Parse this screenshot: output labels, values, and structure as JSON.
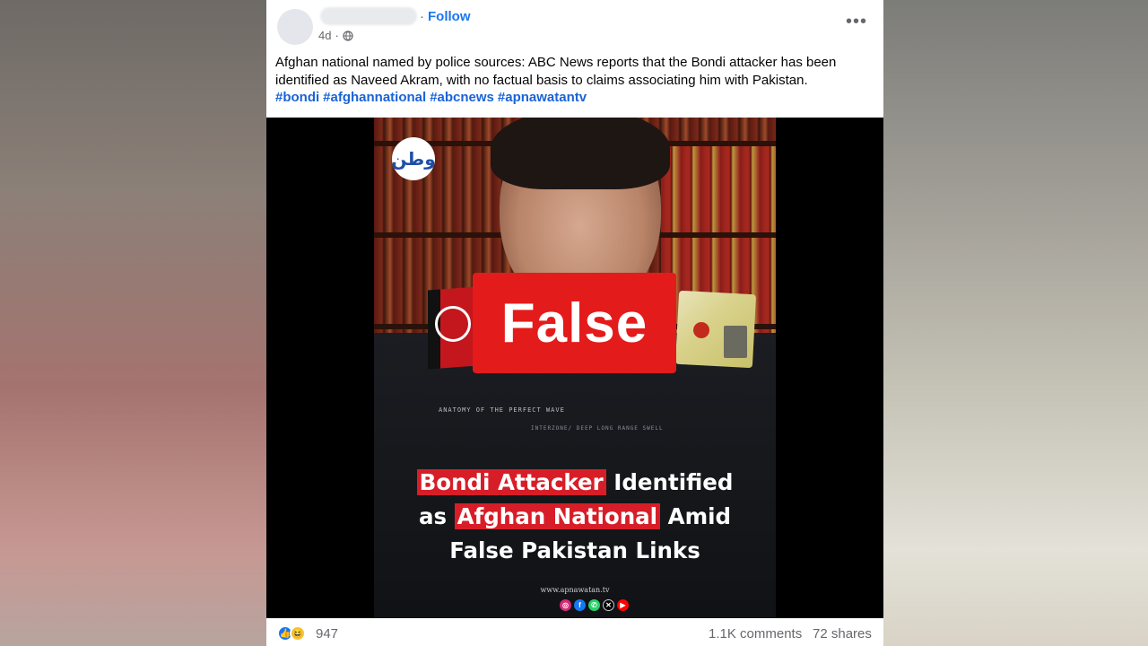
{
  "post": {
    "follow_separator": "·",
    "follow_label": "Follow",
    "time": "4d",
    "time_separator": "·",
    "caption": "Afghan national named by police sources: ABC News reports that the Bondi attacker has been identified as Naveed Akram, with no factual basis to claims associating him with Pakistan.",
    "hashtags": [
      "#bondi",
      "#afghannational",
      "#abcnews",
      "#apnawatantv"
    ],
    "more_label": "•••"
  },
  "media": {
    "logo_text": "وطن",
    "false_badge": "False",
    "shirt_line1": "ANATOMY OF THE PERFECT WAVE",
    "shirt_line2": "INTERZONE/ DEEP LONG RANGE SWELL",
    "headline": {
      "part1": "Bondi Attacker",
      "part2": " Identified",
      "part3": "as ",
      "part4": "Afghan National",
      "part5": " Amid",
      "part6": "False Pakistan Links"
    },
    "website": "www.apnawatan.tv",
    "social_icons": [
      "instagram-icon",
      "facebook-icon",
      "whatsapp-icon",
      "x-icon",
      "youtube-icon"
    ]
  },
  "footer": {
    "reaction_count": "947",
    "comments": "1.1K comments",
    "shares": "72 shares",
    "reactions": [
      "like",
      "haha"
    ]
  },
  "colors": {
    "link_blue": "#1877f2",
    "badge_red": "#e41b1b",
    "headline_highlight": "#d71e28"
  }
}
